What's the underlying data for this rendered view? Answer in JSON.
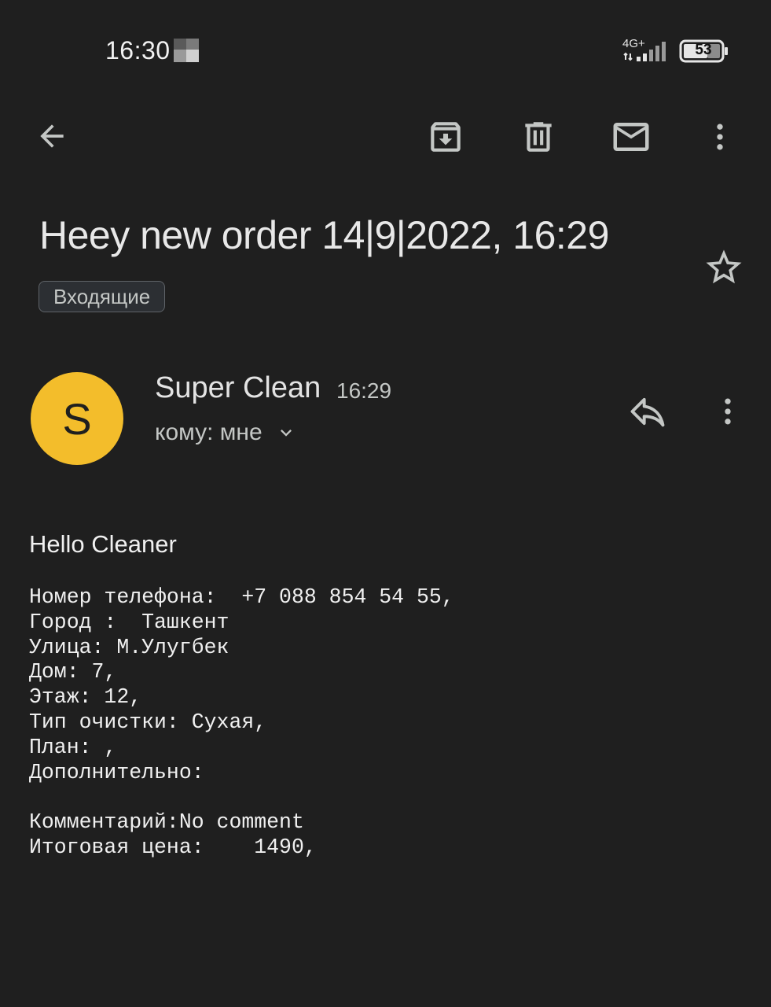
{
  "status_bar": {
    "time": "16:30",
    "network": "4G+",
    "battery": "53"
  },
  "toolbar": {
    "back_icon": "arrow-back-icon",
    "archive_icon": "archive-icon",
    "delete_icon": "trash-icon",
    "mark_unread_icon": "mail-icon",
    "more_icon": "more-vert-icon"
  },
  "email": {
    "subject": "Heey new order 14|9|2022, 16:29",
    "label": "Входящие",
    "starred": false,
    "sender": {
      "initial": "S",
      "name": "Super Clean",
      "time": "16:29",
      "recipient": "кому: мне",
      "avatar_color": "#f3bd2b"
    },
    "body": {
      "greeting": "Hello Cleaner",
      "lines": [
        "Номер телефона:  +7 088 854 54 55,",
        "Город :  Ташкент",
        "Улица: М.Улугбек",
        "Дом: 7,",
        "Этаж: 12,",
        "Тип очистки: Сухая,",
        "План: ,",
        "Дополнительно:",
        "",
        "Комментарий:No comment",
        "Итоговая цена:    1490,"
      ]
    }
  },
  "colors": {
    "background": "#1f1f1f",
    "text": "#e3e3e3",
    "secondary_text": "#c4c7c5",
    "avatar": "#f3bd2b"
  }
}
